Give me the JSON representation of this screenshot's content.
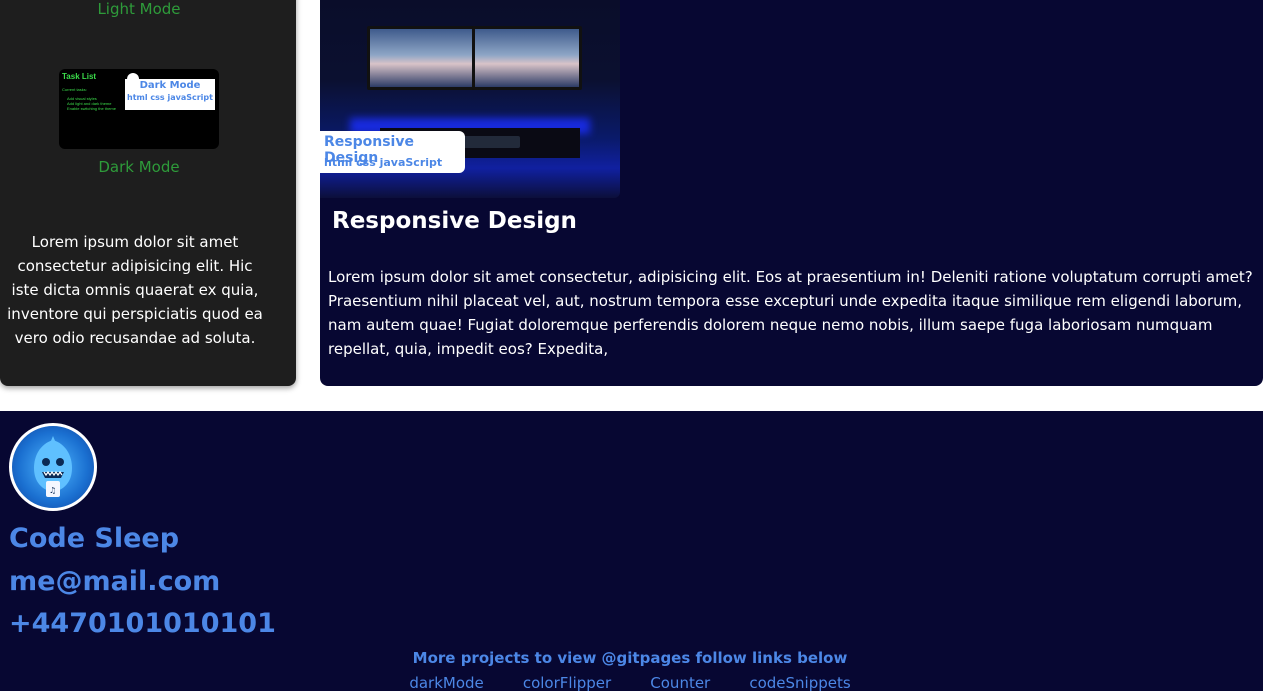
{
  "left_card": {
    "light_mode_label": "Light Mode",
    "dark_mode_label": "Dark Mode",
    "thumbnail": {
      "title": "Task List",
      "subtitle": "Current tasks:",
      "items": [
        "Add visual styles",
        "Add light and dark theme",
        "Enable switching the theme"
      ],
      "badge_title": "Dark Mode",
      "badge_tags": "html css javaScript"
    },
    "description": "Lorem ipsum dolor sit amet consectetur adipisicing elit. Hic iste dicta omnis quaerat ex quia, inventore qui perspiciatis quod ea vero odio recusandae ad soluta."
  },
  "right_card": {
    "badge_title": "Responsive Design",
    "badge_tags": "html css javaScript",
    "title": "Responsive Design",
    "description": "Lorem ipsum dolor sit amet consectetur, adipisicing elit. Eos at praesentium in! Deleniti ratione voluptatum corrupti amet? Praesentium nihil placeat vel, aut, nostrum tempora esse excepturi unde expedita itaque similique rem eligendi laborum, nam autem quae! Fugiat doloremque perferendis dolorem neque nemo nobis, illum saepe fuga laboriosam numquam repellat, quia, impedit eos? Expedita,"
  },
  "footer": {
    "name": "Code Sleep",
    "email": "me@mail.com",
    "phone": "+4470101010101",
    "more_text": "More projects to view @gitpages follow links below",
    "links": [
      "darkMode",
      "colorFlipper",
      "Counter",
      "codeSnippets"
    ]
  },
  "colors": {
    "accent": "#4c87e6",
    "card_dark": "#1e1e1e",
    "navy": "#070732",
    "green_label": "#2e9b3a"
  }
}
